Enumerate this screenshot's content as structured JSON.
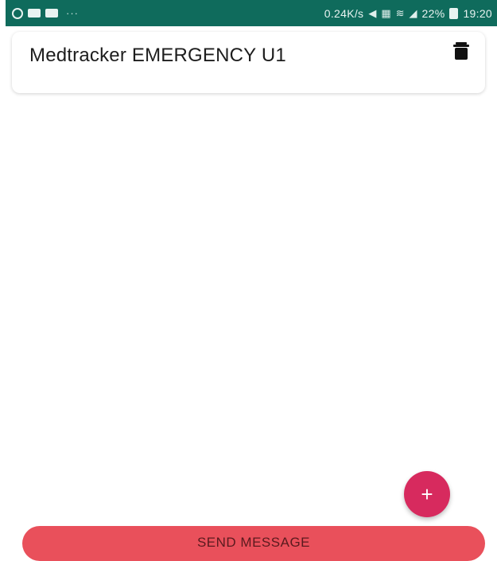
{
  "status_bar": {
    "network_speed": "0.24K/s",
    "signal_text": "22%",
    "time": "19:20",
    "background": "#0f6b5c",
    "icons": [
      "whatsapp-icon",
      "media-icon",
      "media-icon",
      "more-dots-icon",
      "mute-icon",
      "network-icon",
      "wifi-icon",
      "signal-icon",
      "battery-icon"
    ]
  },
  "card": {
    "title": "Medtracker EMERGENCY U1",
    "delete_icon": "trash-icon"
  },
  "fab": {
    "label": "+",
    "color": "#d72a5e"
  },
  "send_button": {
    "label": "SEND MESSAGE",
    "color": "#e9505b"
  }
}
